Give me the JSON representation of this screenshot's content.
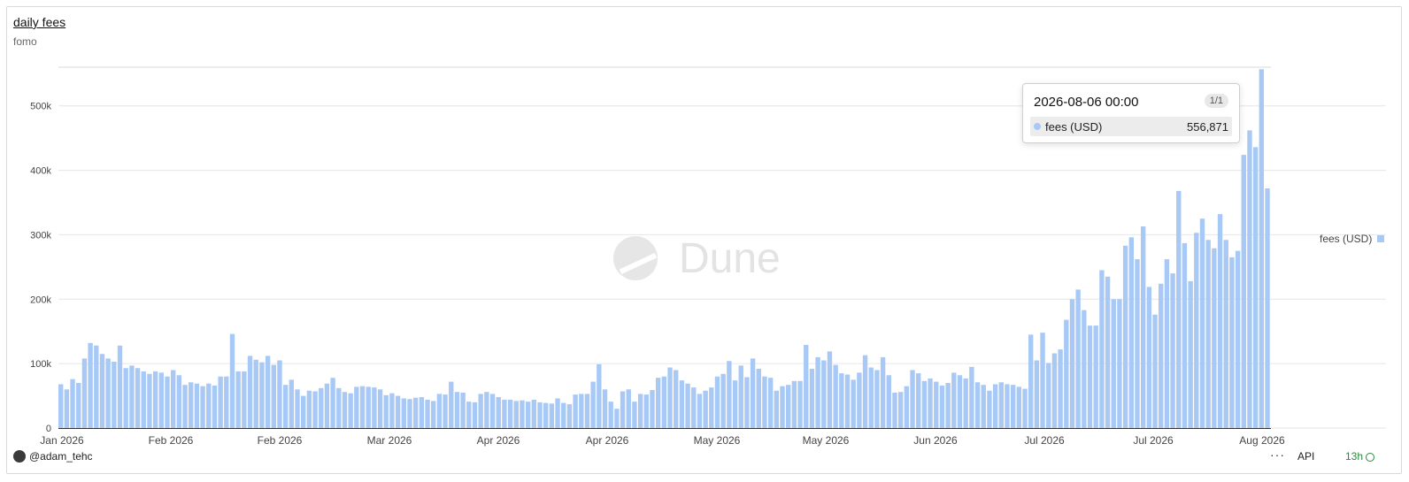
{
  "title": "daily fees",
  "subtitle": "fomo",
  "watermark": "Dune",
  "legend": {
    "label": "fees (USD)",
    "color": "#a8c9f5",
    "placement": "right"
  },
  "tooltip": {
    "date": "2026-08-06 00:00",
    "page": "1/1",
    "series": "fees (USD)",
    "value": "556,871"
  },
  "footer": {
    "user": "@adam_tehc",
    "more": "···",
    "api": "API",
    "time": "13h"
  },
  "colors": {
    "bar": "#a8c9f5",
    "highlight": "#7fb0f0",
    "grid": "#e6e6e6"
  },
  "chart_data": {
    "type": "bar",
    "x_start": "2026-01-01",
    "x_end": "2026-08-08",
    "xticks": [
      "Jan 2026",
      "Feb 2026",
      "Feb 2026",
      "Mar 2026",
      "Apr 2026",
      "Apr 2026",
      "May 2026",
      "May 2026",
      "Jun 2026",
      "Jul 2026",
      "Jul 2026",
      "Aug 2026"
    ],
    "yticks": [
      "0",
      "100k",
      "200k",
      "300k",
      "400k",
      "500k"
    ],
    "ylim": [
      0,
      560000
    ],
    "grid": true,
    "series": [
      {
        "name": "fees (USD)",
        "values": [
          68000,
          60000,
          76000,
          70000,
          108000,
          132000,
          128000,
          115000,
          108000,
          103000,
          128000,
          93000,
          97000,
          93000,
          88000,
          84000,
          88000,
          86000,
          80000,
          90000,
          82000,
          67000,
          71000,
          69000,
          65000,
          69000,
          66000,
          80000,
          80000,
          146000,
          88000,
          88000,
          112000,
          106000,
          102000,
          112000,
          98000,
          105000,
          67000,
          75000,
          60000,
          50000,
          58000,
          57000,
          62000,
          69000,
          78000,
          62000,
          56000,
          54000,
          64000,
          65000,
          64000,
          63000,
          60000,
          51000,
          54000,
          50000,
          46000,
          45000,
          47000,
          48000,
          44000,
          42000,
          53000,
          52000,
          72000,
          56000,
          55000,
          41000,
          40000,
          53000,
          56000,
          53000,
          48000,
          44000,
          44000,
          42000,
          43000,
          41000,
          44000,
          40000,
          39000,
          38000,
          46000,
          39000,
          37000,
          52000,
          53000,
          53000,
          72000,
          99000,
          60000,
          41000,
          30000,
          57000,
          60000,
          41000,
          53000,
          52000,
          59000,
          78000,
          80000,
          94000,
          90000,
          74000,
          69000,
          63000,
          53000,
          58000,
          63000,
          80000,
          84000,
          104000,
          74000,
          97000,
          79000,
          108000,
          92000,
          80000,
          78000,
          58000,
          65000,
          67000,
          73000,
          73000,
          129000,
          92000,
          110000,
          105000,
          119000,
          98000,
          85000,
          83000,
          75000,
          86000,
          113000,
          94000,
          90000,
          110000,
          82000,
          55000,
          56000,
          65000,
          90000,
          85000,
          73000,
          77000,
          72000,
          66000,
          70000,
          86000,
          82000,
          77000,
          95000,
          71000,
          67000,
          58000,
          68000,
          71000,
          68000,
          67000,
          64000,
          61000,
          145000,
          105000,
          148000,
          101000,
          116000,
          122000,
          168000,
          200000,
          215000,
          183000,
          159000,
          159000,
          245000,
          235000,
          200000,
          200000,
          283000,
          296000,
          262000,
          313000,
          219000,
          176000,
          224000,
          262000,
          240000,
          368000,
          287000,
          228000,
          303000,
          325000,
          292000,
          279000,
          332000,
          292000,
          265000,
          275000,
          424000,
          462000,
          436000,
          556871,
          372000
        ],
        "highlight": "2026-08-06"
      }
    ]
  }
}
